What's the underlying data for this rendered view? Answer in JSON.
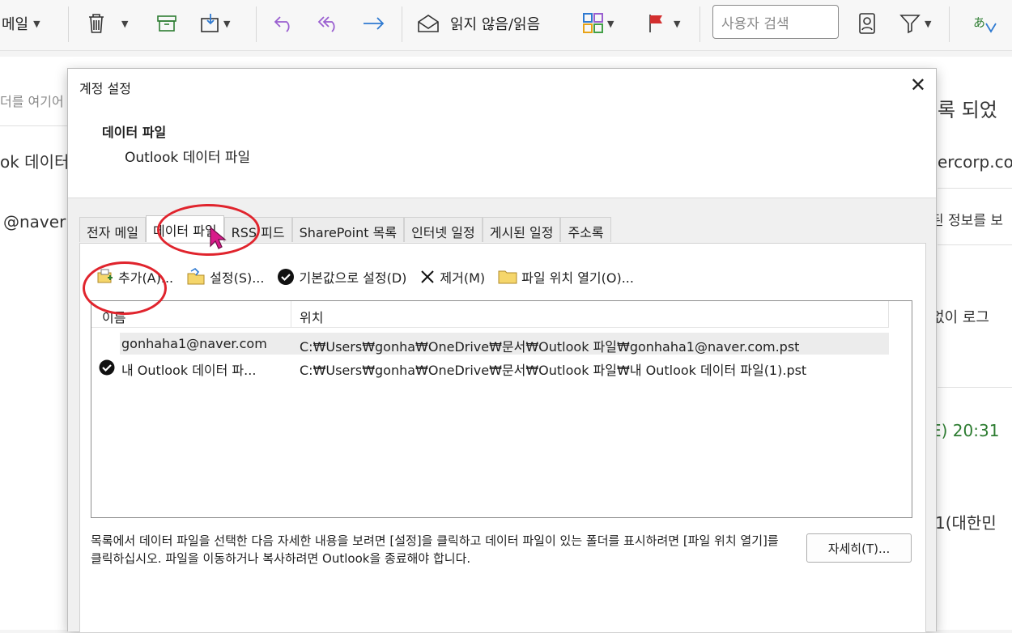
{
  "ribbon": {
    "mail_label": "메일",
    "read_unread_label": "읽지 않음/읽음",
    "search_placeholder": "사용자 검색"
  },
  "background": {
    "left_texts": [
      "더를 여기어",
      "ok 데이터",
      "@naver"
    ],
    "right_texts": [
      "록 되었",
      "ercorp.com",
      "된 정보를 보",
      "없이 로그",
      "E) 20:31",
      "1(대한민"
    ]
  },
  "dialog": {
    "title": "계정 설정",
    "header_title": "데이터 파일",
    "header_subtitle": "Outlook 데이터 파일",
    "tabs": [
      "전자 메일",
      "데이터 파일",
      "RSS 피드",
      "SharePoint 목록",
      "인터넷 일정",
      "게시된 일정",
      "주소록"
    ],
    "toolbar": {
      "add": "추가(A)...",
      "settings": "설정(S)...",
      "set_default": "기본값으로 설정(D)",
      "remove": "제거(M)",
      "open_location": "파일 위치 열기(O)..."
    },
    "columns": {
      "name": "이름",
      "location": "위치"
    },
    "rows": [
      {
        "name": "gonhaha1@naver.com",
        "location": "C:₩Users₩gonha₩OneDrive₩문서₩Outlook 파일₩gonhaha1@naver.com.pst"
      },
      {
        "name": "내 Outlook 데이터 파...",
        "location": "C:₩Users₩gonha₩OneDrive₩문서₩Outlook 파일₩내 Outlook 데이터 파일(1).pst"
      }
    ],
    "note": "목록에서 데이터 파일을 선택한 다음 자세한 내용을 보려면 [설정]을 클릭하고 데이터 파일이 있는 폴더를 표시하려면 [파일 위치 열기]를 클릭하십시오. 파일을 이동하거나 복사하려면 Outlook을 종료해야 합니다.",
    "details_button": "자세히(T)..."
  },
  "colors": {
    "accent_red": "#e0242d",
    "cursor": "#d81b8a",
    "arrow_blue": "#2f7ad1",
    "reply_purple": "#9a5fd0"
  }
}
